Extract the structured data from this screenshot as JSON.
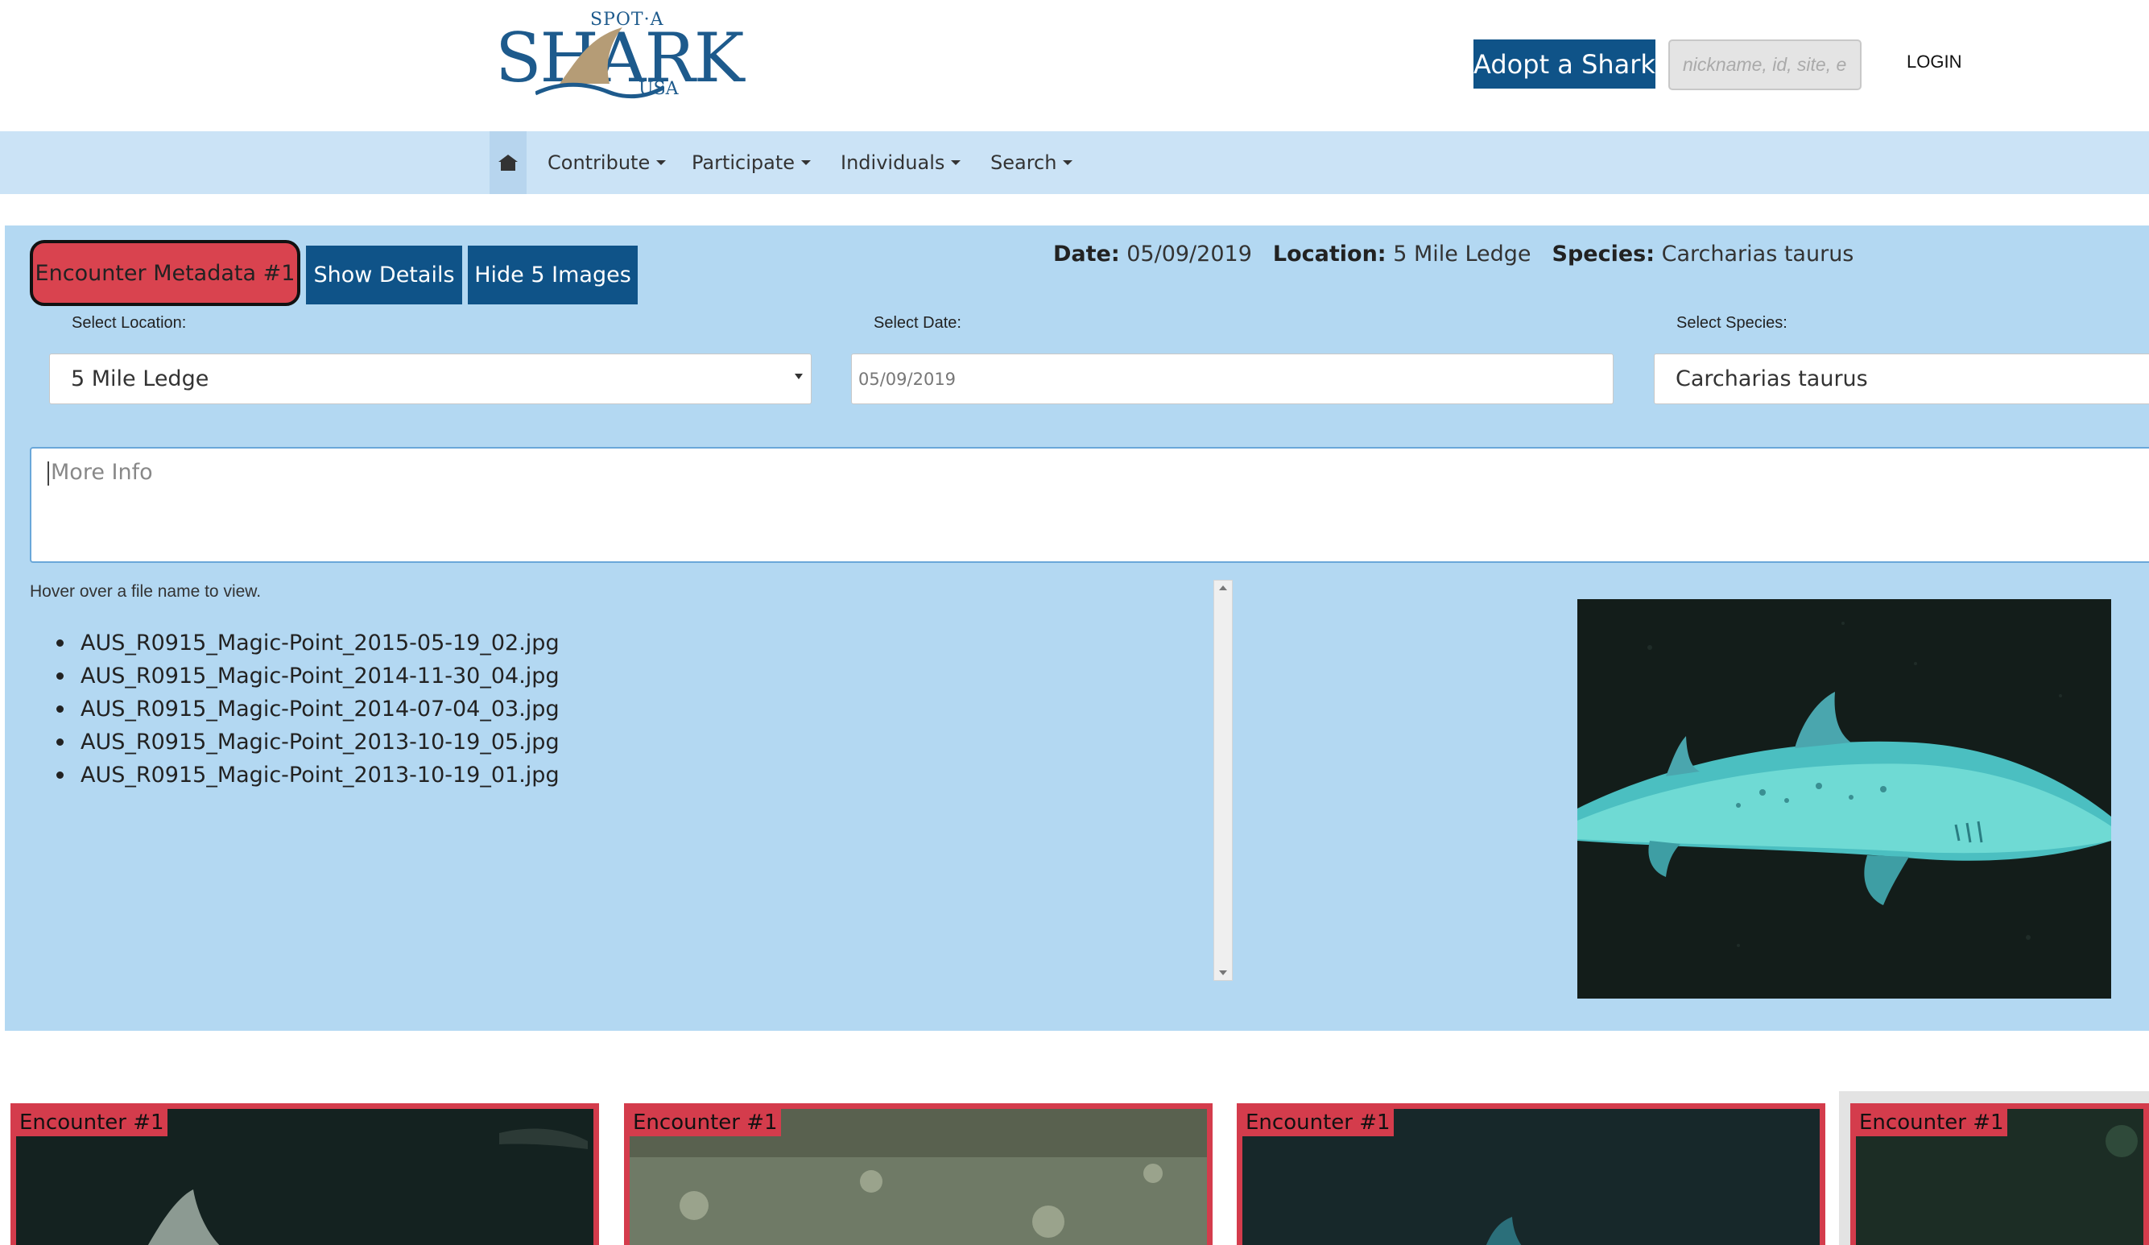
{
  "header": {
    "logo": {
      "top_text": "SPOT·A",
      "main_text": "SHARK",
      "bottom_text": "USA"
    },
    "adopt_button": "Adopt a Shark",
    "search_placeholder": "nickname, id, site, e",
    "login": "LOGIN"
  },
  "nav": {
    "home_icon": "home-icon",
    "items": [
      {
        "label": "Contribute"
      },
      {
        "label": "Participate"
      },
      {
        "label": "Individuals"
      },
      {
        "label": "Search"
      }
    ]
  },
  "encounter": {
    "meta_button": "Encounter Metadata #1",
    "show_details_button": "Show Details",
    "hide_images_button": "Hide 5 Images",
    "summary": {
      "date_label": "Date:",
      "date_value": "05/09/2019",
      "location_label": "Location:",
      "location_value": "5 Mile Ledge",
      "species_label": "Species:",
      "species_value": "Carcharias taurus"
    },
    "location_field": {
      "label": "Select Location:",
      "value": "5 Mile Ledge"
    },
    "date_field": {
      "label": "Select Date:",
      "value": "05/09/2019"
    },
    "species_field": {
      "label": "Select Species:",
      "value": "Carcharias taurus"
    },
    "more_info_placeholder": "More Info",
    "hover_hint": "Hover over a file name to view.",
    "files": [
      "AUS_R0915_Magic-Point_2015-05-19_02.jpg",
      "AUS_R0915_Magic-Point_2014-11-30_04.jpg",
      "AUS_R0915_Magic-Point_2014-07-04_03.jpg",
      "AUS_R0915_Magic-Point_2013-10-19_05.jpg",
      "AUS_R0915_Magic-Point_2013-10-19_01.jpg"
    ]
  },
  "thumbnails": [
    {
      "label": "Encounter #1"
    },
    {
      "label": "Encounter #1"
    },
    {
      "label": "Encounter #1"
    },
    {
      "label": "Encounter #1"
    }
  ],
  "colors": {
    "brand_blue": "#0f5388",
    "nav_bg": "#cbe3f6",
    "panel_bg": "#b3d8f2",
    "alert_red": "#d9434f"
  }
}
